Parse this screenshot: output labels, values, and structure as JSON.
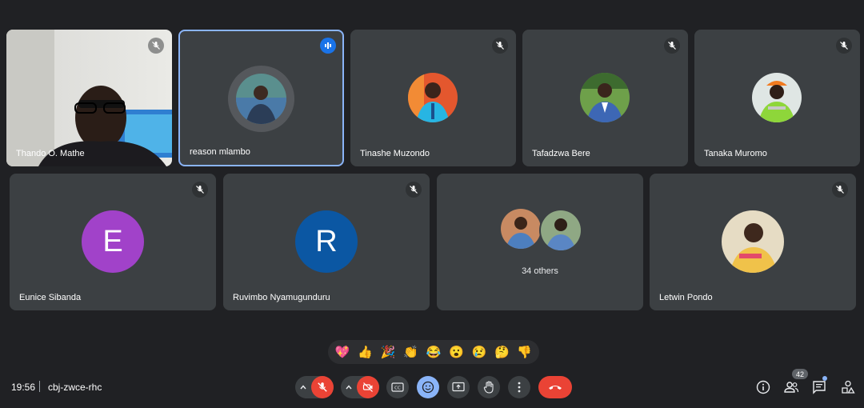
{
  "participants_row1": [
    {
      "name": "Thando O. Mathe",
      "mic": "muted",
      "video": "on"
    },
    {
      "name": "reason mlambo",
      "mic": "speaking",
      "video": "off"
    },
    {
      "name": "Tinashe Muzondo",
      "mic": "muted",
      "video": "off"
    },
    {
      "name": "Tafadzwa Bere",
      "mic": "muted",
      "video": "off"
    },
    {
      "name": "Tanaka Muromo",
      "mic": "muted",
      "video": "off"
    }
  ],
  "participants_row2": [
    {
      "name": "Eunice Sibanda",
      "initial": "E",
      "color": "#a142c9",
      "mic": "muted"
    },
    {
      "name": "Ruvimbo Nyamugunduru",
      "initial": "R",
      "color": "#0b57a3",
      "mic": "muted"
    },
    {
      "others_label": "34 others"
    },
    {
      "name": "Letwin Pondo",
      "mic": "muted"
    }
  ],
  "reactions": [
    "💖",
    "👍",
    "🎉",
    "👏",
    "😂",
    "😮",
    "😢",
    "🤔",
    "👎"
  ],
  "bottom_bar": {
    "time": "19:56",
    "meeting_code": "cbj-zwce-rhc",
    "participant_count": "42"
  },
  "colors": {
    "background": "#202124",
    "tile": "#3c4043",
    "accent_blue": "#8ab4f8",
    "danger_red": "#ea4335"
  },
  "icons": {
    "mic": "mic-off-icon",
    "camera": "camera-off-icon",
    "captions": "captions-icon",
    "emoji": "emoji-icon",
    "present": "present-icon",
    "hand": "raise-hand-icon",
    "more": "more-vert-icon",
    "end": "end-call-icon",
    "info": "info-icon",
    "people": "people-icon",
    "chat": "chat-icon",
    "activities": "activities-icon"
  }
}
